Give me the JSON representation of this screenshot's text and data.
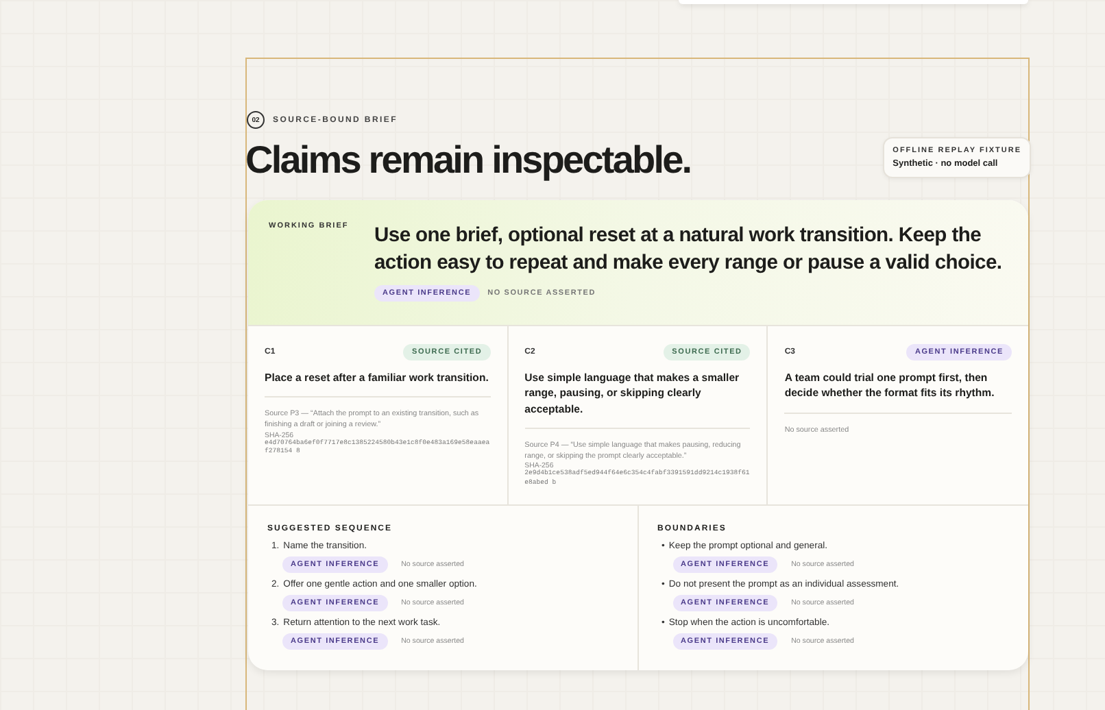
{
  "section": {
    "number": "02",
    "eyebrow": "SOURCE-BOUND BRIEF",
    "title": "Claims remain inspectable."
  },
  "fixture": {
    "label": "OFFLINE REPLAY FIXTURE",
    "note": "Synthetic · no model call"
  },
  "brief": {
    "label": "WORKING BRIEF",
    "text": "Use one brief, optional reset at a natural work transition. Keep the action easy to repeat and make every range or pause a valid choice.",
    "badge": {
      "kind": "inference",
      "text": "AGENT INFERENCE"
    },
    "source": "NO SOURCE ASSERTED"
  },
  "claims": [
    {
      "id": "C1",
      "badge": {
        "kind": "cited",
        "text": "SOURCE CITED"
      },
      "text": "Place a reset after a familiar work transition.",
      "source": "Source P3 — “Attach the prompt to an existing transition, such as finishing a draft or joining a review.”",
      "hash_label": "SHA-256",
      "hash": "e4d70764ba6ef0f7717e8c1385224580b43e1c8f0e483a169e58eaaeaf278154 8"
    },
    {
      "id": "C2",
      "badge": {
        "kind": "cited",
        "text": "SOURCE CITED"
      },
      "text": "Use simple language that makes a smaller range, pausing, or skipping clearly acceptable.",
      "source": "Source P4 — “Use simple language that makes pausing, reducing range, or skipping the prompt clearly acceptable.”",
      "hash_label": "SHA-256",
      "hash": "2e9d4b1ce538adf5ed944f64e6c354c4fabf3391591dd9214c1938f61e8abed b"
    },
    {
      "id": "C3",
      "badge": {
        "kind": "inference",
        "text": "AGENT INFERENCE"
      },
      "text": "A team could trial one prompt first, then decide whether the format fits its rhythm.",
      "source": "No source asserted"
    }
  ],
  "lists": [
    {
      "title": "SUGGESTED SEQUENCE",
      "items": [
        {
          "marker": "1.",
          "text": "Name the transition.",
          "badge": {
            "kind": "inference",
            "text": "AGENT INFERENCE"
          },
          "source": "No source asserted"
        },
        {
          "marker": "2.",
          "text": "Offer one gentle action and one smaller option.",
          "badge": {
            "kind": "inference",
            "text": "AGENT INFERENCE"
          },
          "source": "No source asserted"
        },
        {
          "marker": "3.",
          "text": "Return attention to the next work task.",
          "badge": {
            "kind": "inference",
            "text": "AGENT INFERENCE"
          },
          "source": "No source asserted"
        }
      ]
    },
    {
      "title": "BOUNDARIES",
      "items": [
        {
          "marker": "•",
          "text": "Keep the prompt optional and general.",
          "badge": {
            "kind": "inference",
            "text": "AGENT INFERENCE"
          },
          "source": "No source asserted"
        },
        {
          "marker": "•",
          "text": "Do not present the prompt as an individual assessment.",
          "badge": {
            "kind": "inference",
            "text": "AGENT INFERENCE"
          },
          "source": "No source asserted"
        },
        {
          "marker": "•",
          "text": "Stop when the action is uncomfortable.",
          "badge": {
            "kind": "inference",
            "text": "AGENT INFERENCE"
          },
          "source": "No source asserted"
        }
      ]
    }
  ]
}
